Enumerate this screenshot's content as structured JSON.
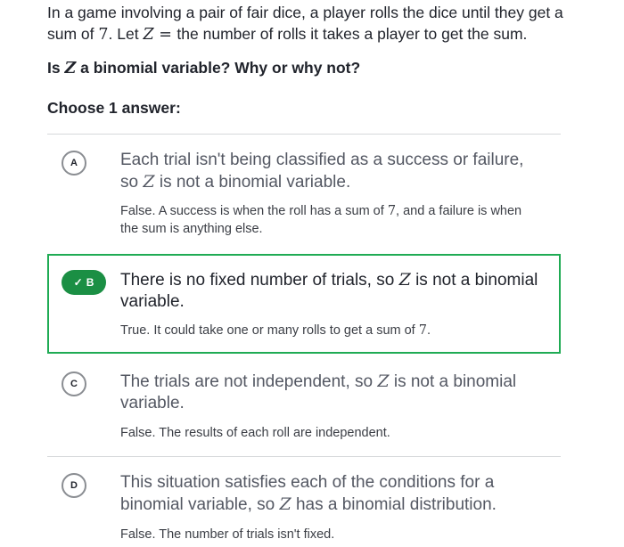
{
  "question": {
    "line1_part1": "In a game involving a pair of fair dice, a player rolls the dice until they get a",
    "line2_part1": "sum of ",
    "seven": "7",
    "line2_part2": ". Let ",
    "var": "Z",
    "eq": " = ",
    "line2_part3": "the number of rolls it takes a player to get the sum."
  },
  "prompt": {
    "before": "Is ",
    "var": "Z",
    "after": " a binomial variable? Why or why not?"
  },
  "choose_label": "Choose 1 answer:",
  "choices": [
    {
      "letter": "A",
      "text_a": "Each trial isn't being classified as a success or failure,",
      "text_b_before": "so ",
      "var": "Z",
      "text_b_after": " is not a binomial variable.",
      "explanation_before": "False. A success is when the roll has a sum of ",
      "explanation_num": "7",
      "explanation_after": ", and a failure is when the sum is anything else."
    },
    {
      "letter": "B",
      "check": "✓",
      "text_before": "There is no fixed number of trials, so ",
      "var": "Z",
      "text_after": " is not a binomial variable.",
      "explanation_before": "True. It could take one or many rolls to get a sum of ",
      "explanation_num": "7",
      "explanation_after": "."
    },
    {
      "letter": "C",
      "text_before": "The trials are not independent, so ",
      "var": "Z",
      "text_after": " is not a binomial variable.",
      "explanation": "False. The results of each roll are independent."
    },
    {
      "letter": "D",
      "text_before": "This situation satisfies each of the conditions for a binomial variable, so ",
      "var": "Z",
      "text_after": " has a binomial distribution.",
      "explanation": "False. The number of trials isn't fixed."
    }
  ],
  "colors": {
    "correct": "#1fab54",
    "correct_badge": "#1b8f44"
  }
}
